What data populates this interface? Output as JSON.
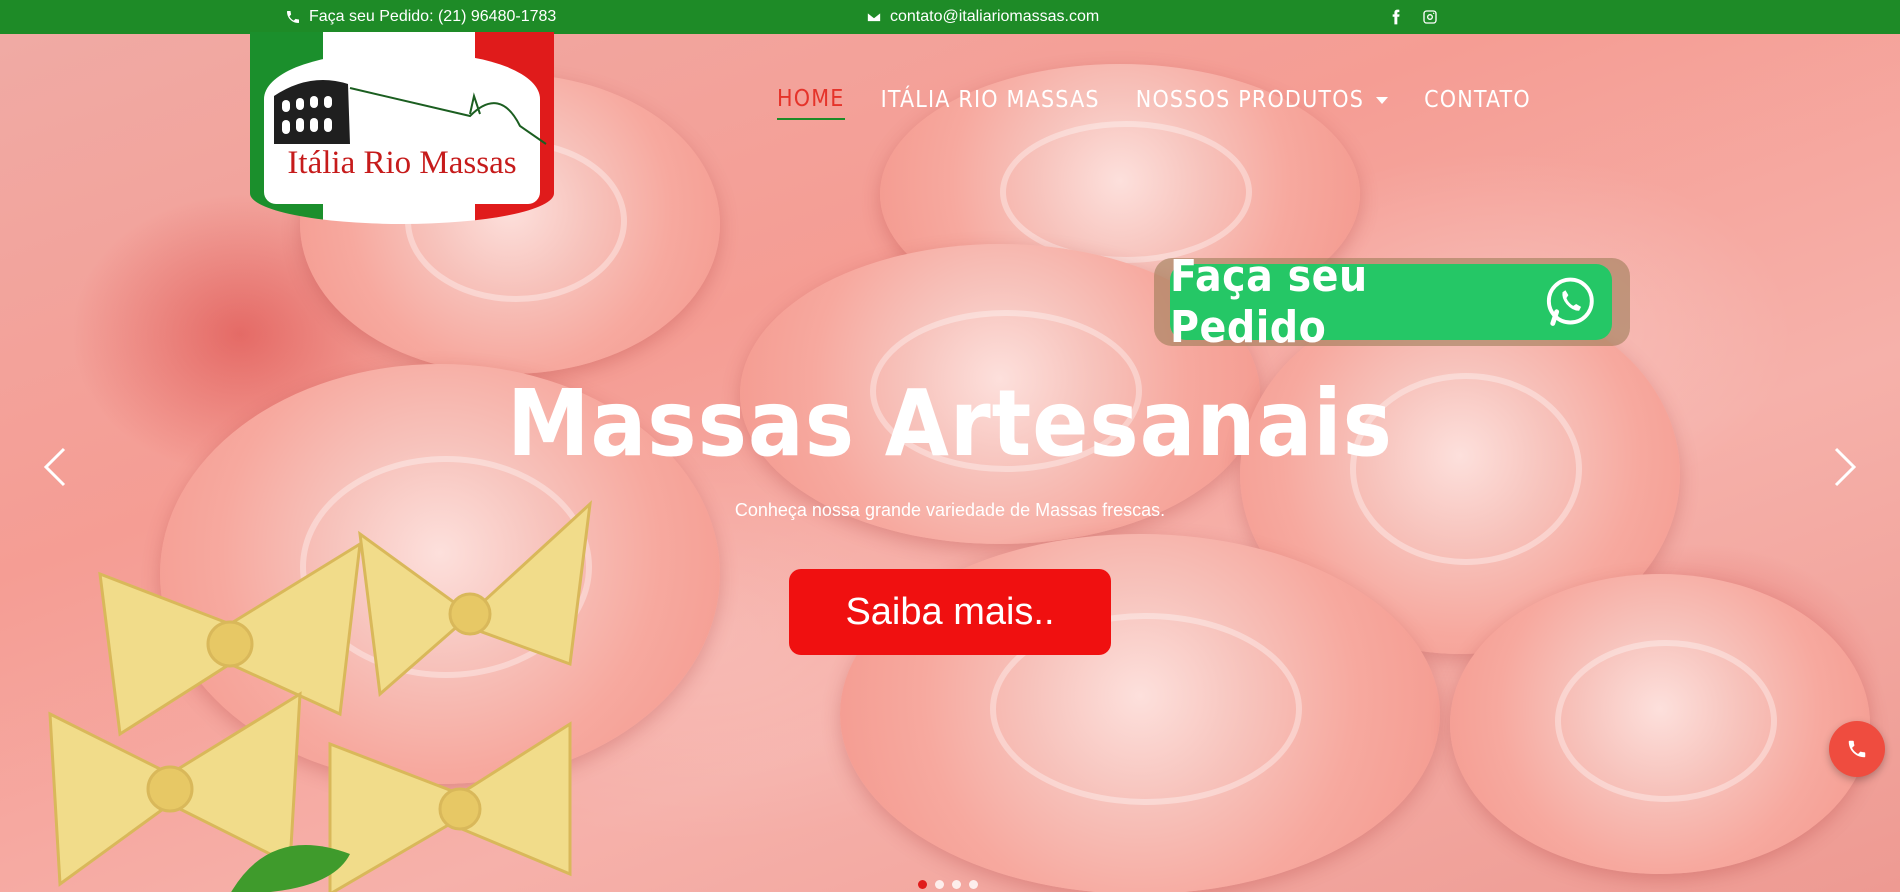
{
  "topbar": {
    "phone_text": "Faça seu Pedido: (21) 96480-1783",
    "email_text": "contato@italiariomassas.com",
    "icons": [
      "phone-icon",
      "envelope-icon",
      "facebook-icon",
      "instagram-icon"
    ],
    "bg_color": "#1e8b27",
    "stripe_color": "#e11919"
  },
  "logo": {
    "text": "Itália Rio Massas"
  },
  "nav": {
    "items": [
      {
        "label": "HOME",
        "active": true
      },
      {
        "label": "ITÁLIA RIO MASSAS",
        "active": false
      },
      {
        "label": "NOSSOS PRODUTOS",
        "active": false,
        "has_dropdown": true
      },
      {
        "label": "CONTATO",
        "active": false
      }
    ],
    "active_color": "#e5332a"
  },
  "whatsapp": {
    "label": "Faça seu Pedido",
    "icon": "whatsapp-icon",
    "color": "#25c766"
  },
  "hero": {
    "title": "Massas Artesanais",
    "subtitle": "Conheça nossa grande variedade de Massas frescas.",
    "cta_label": "Saiba mais..",
    "cta_color": "#f01010",
    "prev_icon": "chevron-left-icon",
    "next_icon": "chevron-right-icon",
    "slide_count": 4,
    "active_slide": 1
  },
  "floating_call": {
    "icon": "phone-icon",
    "color": "#ef4c3f"
  }
}
